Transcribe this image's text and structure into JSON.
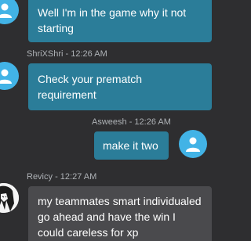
{
  "messages": [
    {
      "sender": "",
      "time": "",
      "text": "Well I'm in the game why it not starting",
      "avatar_icon": "user-icon"
    },
    {
      "sender": "ShriXShri",
      "time": "12:26 AM",
      "text": "Check your prematch requirement",
      "avatar_icon": "user-icon"
    },
    {
      "sender": "Asweesh",
      "time": "12:26 AM",
      "text": "make it two",
      "avatar_icon": "user-icon"
    },
    {
      "sender": "Revicy",
      "time": "12:27 AM",
      "text": "my teammates smart individualed go ahead and have the win I could careless for xp",
      "avatar_icon": "anime-character-avatar"
    }
  ],
  "colors": {
    "background": "#2e2e30",
    "accent_bubble": "#2b7d99",
    "neutral_bubble": "#4a4a4d",
    "avatar": "#42b3e6",
    "meta_text": "#aeb2b6"
  }
}
